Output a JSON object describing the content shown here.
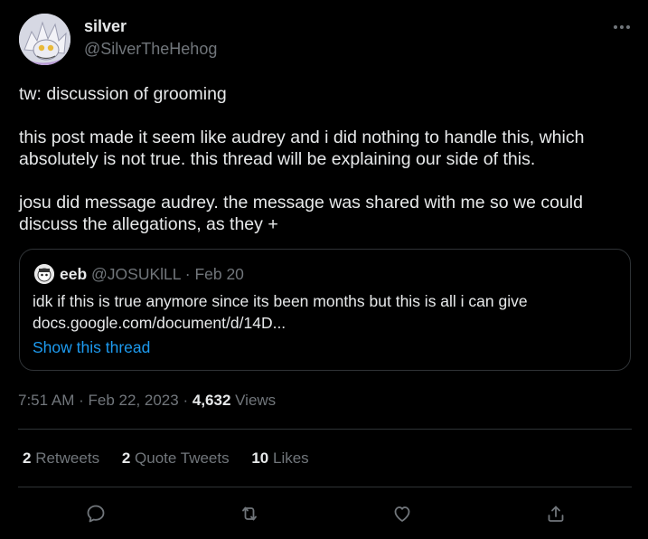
{
  "author": {
    "name": "silver",
    "handle": "@SilverTheHehog",
    "avatar_icon": "silver-avatar"
  },
  "menu_icon": "more-dots-icon",
  "tweet": {
    "paragraphs": [
      "tw: discussion of grooming",
      "this post made it seem like audrey and i did nothing to handle this, which absolutely is not true. this thread will be explaining our side of this.",
      "josu did message audrey. the message was shared with me so we could discuss the allegations, as they +"
    ]
  },
  "quote": {
    "name": "eeb",
    "handle": "@JOSUKlLL",
    "separator": "·",
    "date": "Feb 20",
    "text_lines": [
      "idk if this is true anymore since its been months but this is all i can give",
      "docs.google.com/document/d/14D..."
    ],
    "show_thread": "Show this thread"
  },
  "meta": {
    "time": "7:51 AM",
    "separator": "·",
    "date": "Feb 22, 2023",
    "views_count": "4,632",
    "views_label": "Views"
  },
  "stats": [
    {
      "count": "2",
      "label": "Retweets"
    },
    {
      "count": "2",
      "label": "Quote Tweets"
    },
    {
      "count": "10",
      "label": "Likes"
    }
  ],
  "colors": {
    "background": "#000000",
    "text": "#e7e9ea",
    "secondary": "#71767b",
    "link": "#1d9bf0",
    "border": "#2f3336"
  }
}
